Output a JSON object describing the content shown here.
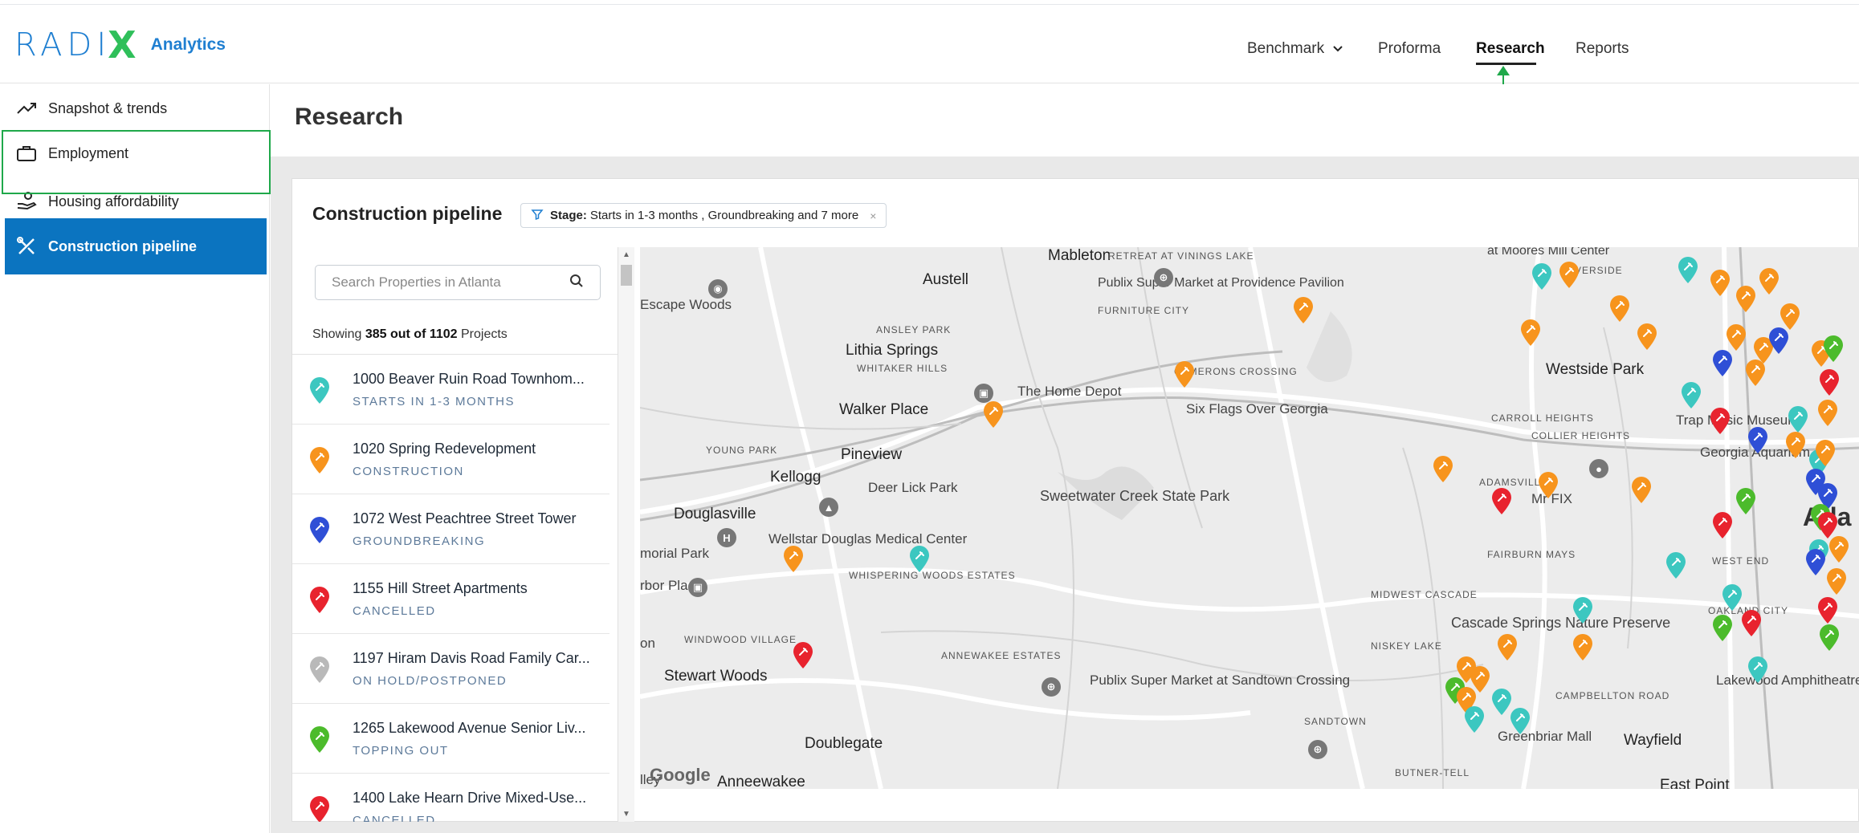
{
  "brand": {
    "logo_word": "RADI",
    "logo_x": "X",
    "sub": "Analytics"
  },
  "nav": {
    "benchmark": "Benchmark",
    "proforma": "Proforma",
    "research": "Research",
    "reports": "Reports"
  },
  "sidebar": {
    "items": [
      {
        "label": "Snapshot & trends",
        "icon": "trend-up-icon"
      },
      {
        "label": "Employment",
        "icon": "briefcase-icon"
      },
      {
        "label": "Housing affordability",
        "icon": "hand-coins-icon"
      },
      {
        "label": "Construction pipeline",
        "icon": "tools-icon",
        "active": true
      }
    ]
  },
  "page": {
    "title": "Research"
  },
  "card": {
    "title": "Construction pipeline",
    "filter": {
      "key": "Stage:",
      "value": "Starts in 1-3 months , Groundbreaking and 7 more",
      "clear": "×"
    }
  },
  "search": {
    "placeholder": "Search Properties in Atlanta"
  },
  "showing": {
    "prefix": "Showing",
    "count": "385 out of 1102",
    "suffix": "Projects"
  },
  "projects": [
    {
      "name": "1000 Beaver Ruin Road Townhom...",
      "stage": "STARTS IN 1-3 MONTHS",
      "color": "#3cc7c0"
    },
    {
      "name": "1020 Spring Redevelopment",
      "stage": "CONSTRUCTION",
      "color": "#f7941d"
    },
    {
      "name": "1072 West Peachtree Street Tower",
      "stage": "GROUNDBREAKING",
      "color": "#2f4fd6"
    },
    {
      "name": "1155 Hill Street Apartments",
      "stage": "CANCELLED",
      "color": "#e8232e"
    },
    {
      "name": "1197 Hiram Davis Road Family Car...",
      "stage": "ON HOLD/POSTPONED",
      "color": "#b9b9b9"
    },
    {
      "name": "1265 Lakewood Avenue Senior Liv...",
      "stage": "TOPPING OUT",
      "color": "#4cbb2c"
    },
    {
      "name": "1400 Lake Hearn Drive Mixed-Use...",
      "stage": "CANCELLED",
      "color": "#e8232e"
    }
  ],
  "map": {
    "labels": {
      "mableton": "Mableton",
      "retreat": "RETREAT AT VININGS LAKE",
      "austell": "Austell",
      "publix_prov": "Publix Super Market at Providence Pavilion",
      "escape": "Escape Woods",
      "furniture": "FURNITURE CITY",
      "ansley": "ANSLEY PARK",
      "lithia": "Lithia Springs",
      "whitaker": "WHITAKER HILLS",
      "home_depot": "The Home Depot",
      "cameron": "CAMERONS CROSSING",
      "westside": "Westside Park",
      "walker": "Walker Place",
      "six_flags": "Six Flags Over Georgia",
      "carroll": "CARROLL HEIGHTS",
      "trap": "Trap Music Museum",
      "young": "YOUNG PARK",
      "pineview": "Pineview",
      "collier": "COLLIER HEIGHTS",
      "ga_aquarium": "Georgia Aquarium",
      "kellogg": "Kellogg",
      "deer_lick": "Deer Lick Park",
      "adamsville": "ADAMSVILLE",
      "sweetwater": "Sweetwater Creek State Park",
      "mrfix": "Mr FIX",
      "douglasville": "Douglasville",
      "atl": "Atla",
      "wellstar": "Wellstar Douglas Medical Center",
      "memorial": "morial Park",
      "fairburn": "FAIRBURN MAYS",
      "west_end": "WEST END",
      "whispering": "WHISPERING WOODS ESTATES",
      "arbor": "rbor Place",
      "midwest": "MIDWEST CASCADE",
      "oakland": "OAKLAND CITY",
      "windwood": "WINDWOOD VILLAGE",
      "cascade": "Cascade Springs Nature Preserve",
      "niskey": "NISKEY LAKE",
      "annewakee_est": "ANNEWAKEE ESTATES",
      "stewart": "Stewart Woods",
      "publix_sand": "Publix Super Market at Sandtown Crossing",
      "lakewood": "Lakewood Amphitheatre",
      "campbellton": "CAMPBELLTON ROAD",
      "sandtown": "SANDTOWN",
      "doublegate": "Doublegate",
      "greenbriar": "Greenbriar Mall",
      "wayfield": "Wayfield",
      "butner": "BUTNER-TELL",
      "anneewakee": "Anneewakee",
      "east_point": "East Point",
      "river_side": "RIVERSIDE",
      "moores": "at Moores Mill Center",
      "on": "on",
      "lley": "lley",
      "google": "Google"
    }
  }
}
